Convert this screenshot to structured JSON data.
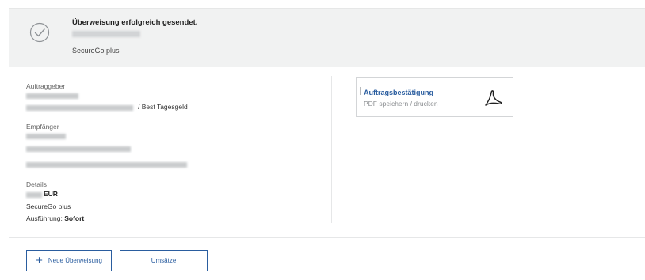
{
  "banner": {
    "title": "Überweisung erfolgreich gesendet.",
    "product": "SecureGo plus"
  },
  "sender": {
    "label": "Auftraggeber",
    "account_suffix": "/ Best Tagesgeld"
  },
  "recipient": {
    "label": "Empfänger"
  },
  "details": {
    "label": "Details",
    "currency": "EUR",
    "method": "SecureGo plus",
    "execution_label": "Ausführung:",
    "execution_value": "Sofort"
  },
  "document": {
    "title": "Auftragsbestätigung",
    "subtitle": "PDF speichern / drucken"
  },
  "actions": {
    "new_transfer": "Neue Überweisung",
    "sales": "Umsätze"
  },
  "colors": {
    "accent": "#2a5d9f",
    "banner_bg": "#f1f2f2"
  }
}
